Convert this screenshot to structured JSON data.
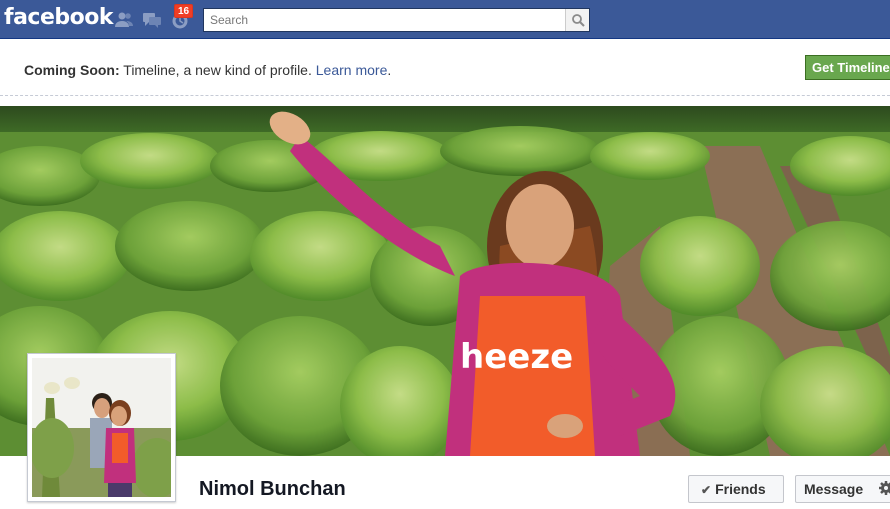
{
  "topbar": {
    "logo": "facebook",
    "notification_count": "16",
    "search_placeholder": "Search"
  },
  "notice": {
    "bold": "Coming Soon:",
    "text": " Timeline, a new kind of profile. ",
    "link": "Learn more",
    "end": ".",
    "button": "Get Timeline"
  },
  "cover": {
    "shirt_text": "heeze"
  },
  "profile": {
    "name": "Nimol Bunchan",
    "friends_label": "Friends",
    "message_label": "Message"
  },
  "colors": {
    "brand_blue": "#3b5998",
    "green_button": "#69a74e",
    "badge_red": "#f03d25"
  }
}
